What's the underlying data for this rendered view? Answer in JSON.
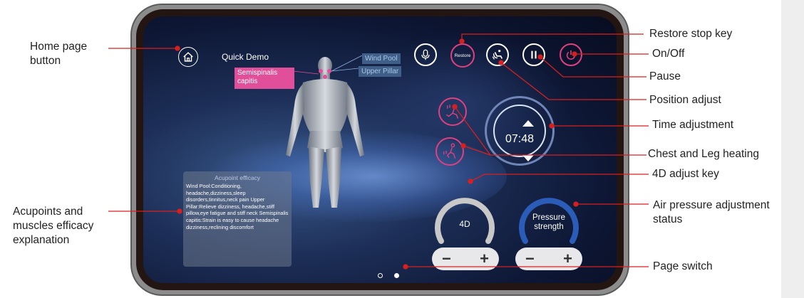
{
  "screen": {
    "home_label": "Home",
    "quick_demo": "Quick Demo",
    "restore_label": "Restore",
    "tags": {
      "wind_pool": "Wind Pool",
      "upper_pillar": "Upper Pillar",
      "semispinalis": "Semispinalis capitis"
    },
    "timer": "07:48",
    "efficacy": {
      "title": "Acupoint efficacy",
      "text": "Wind Pool:Conditioning, headache,dizziness,sleep disorders,tinnitus,neck pain Upper Pillar:Relieve dizziness, headache,stiff pillow,eye fatigue and stiff neck Semispinalis capitis:Strain is easy to cause headache dizziness,reclining discomfort"
    },
    "dial_4d_label": "4D",
    "dial_pressure_label": "Pressure strength",
    "minus": "−",
    "plus": "+",
    "page_current": 2,
    "page_total": 2
  },
  "callouts": {
    "home": "Home page button",
    "acupoints": "Acupoints and muscles efficacy explanation",
    "restore": "Restore stop key",
    "onoff": "On/Off",
    "pause": "Pause",
    "position": "Position adjust",
    "time": "Time adjustment",
    "heating": "Chest and Leg heating",
    "adjust4d": "4D adjust key",
    "pressure": "Air pressure adjustment status",
    "page": "Page switch"
  },
  "colors": {
    "accent_pink": "#e0407f",
    "pressure_blue": "#2b5cb8",
    "line_red": "#d62020"
  }
}
